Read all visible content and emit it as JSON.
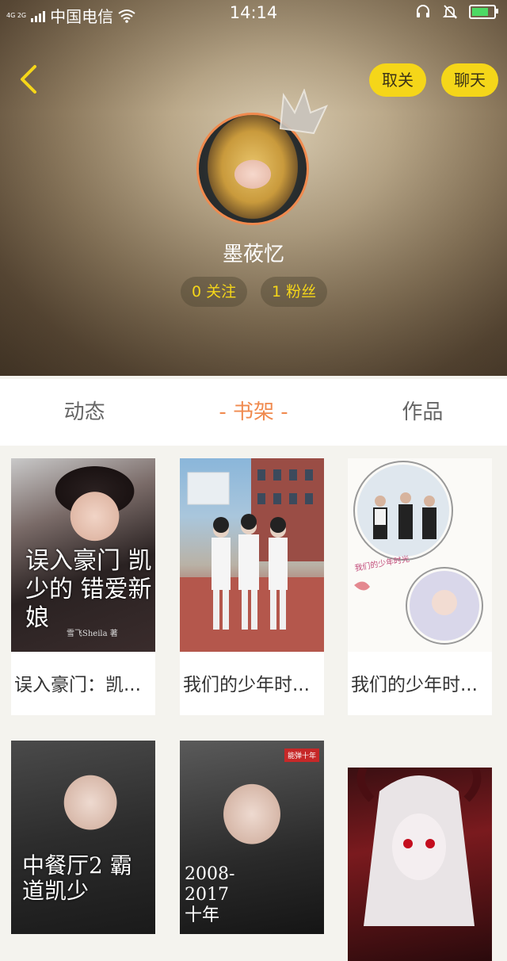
{
  "status_bar": {
    "network_small": "4G 2G",
    "carrier": "中国电信",
    "time": "14:14",
    "battery_level_percent": 75
  },
  "header": {
    "back_icon": "chevron-left-icon",
    "unfollow_label": "取关",
    "chat_label": "聊天",
    "username": "墨莜忆",
    "following": "0 关注",
    "followers": "1 粉丝"
  },
  "tabs": [
    {
      "label": "动态",
      "active": false
    },
    {
      "label": "- 书架 -",
      "active": true
    },
    {
      "label": "作品",
      "active": false
    }
  ],
  "books": [
    {
      "title": "误入豪门：凯...",
      "cover_text": "误入豪门 凯少的 错爱新娘",
      "cover_author": "雪飞Sheila 著"
    },
    {
      "title": "我们的少年时...",
      "cover_text": "",
      "cover_author": ""
    },
    {
      "title": "我们的少年时...",
      "cover_text": "我们的少年时光",
      "cover_author": ""
    },
    {
      "title": "",
      "cover_text": "中餐厅2 霸道凯少",
      "cover_author": ""
    },
    {
      "title": "",
      "cover_text": "2008-2017 十年",
      "cover_author": "能弹十年"
    },
    {
      "title": "",
      "cover_text": "",
      "cover_author": ""
    }
  ],
  "colors": {
    "accent_yellow": "#f5d619",
    "accent_orange": "#f08a4e",
    "background": "#f4f3ee"
  }
}
